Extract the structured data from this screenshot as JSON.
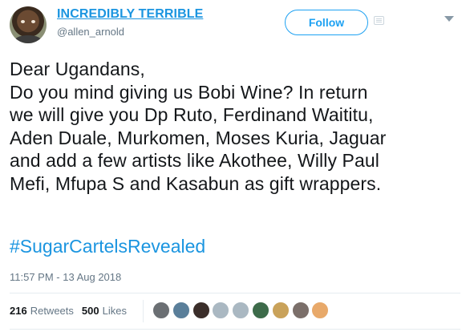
{
  "user": {
    "display_name": "INCREDIBLY TERRIBLE",
    "handle": "@allen_arnold"
  },
  "actions": {
    "follow_label": "Follow"
  },
  "tweet": {
    "text": "Dear Ugandans,\nDo you mind giving us Bobi Wine? In return\nwe will give you Dp Ruto, Ferdinand Waititu,\nAden Duale, Murkomen, Moses Kuria, Jaguar\nand add a few artists like Akothee, Willy Paul\nMefi, Mfupa S and Kasabun as gift wrappers.",
    "hashtag": "#SugarCartelsRevealed",
    "timestamp": "11:57 PM - 13 Aug 2018"
  },
  "stats": {
    "retweets_count": "216",
    "retweets_label": "Retweets",
    "likes_count": "500",
    "likes_label": "Likes"
  },
  "likers": [
    {
      "name": "liker-avatar-1",
      "color": "#6b6f73"
    },
    {
      "name": "liker-avatar-2",
      "color": "#5a7f9a"
    },
    {
      "name": "liker-avatar-3",
      "color": "#3b2e2a"
    },
    {
      "name": "liker-avatar-4",
      "color": "#aab8c2"
    },
    {
      "name": "liker-avatar-5",
      "color": "#aab8c2"
    },
    {
      "name": "liker-avatar-6",
      "color": "#3d6b4a"
    },
    {
      "name": "liker-avatar-7",
      "color": "#c9a25a"
    },
    {
      "name": "liker-avatar-8",
      "color": "#7b6f6a"
    },
    {
      "name": "liker-avatar-9",
      "color": "#e8a96a"
    }
  ],
  "colors": {
    "link": "#1b95e0",
    "accent": "#1da1f2",
    "muted": "#657786"
  }
}
